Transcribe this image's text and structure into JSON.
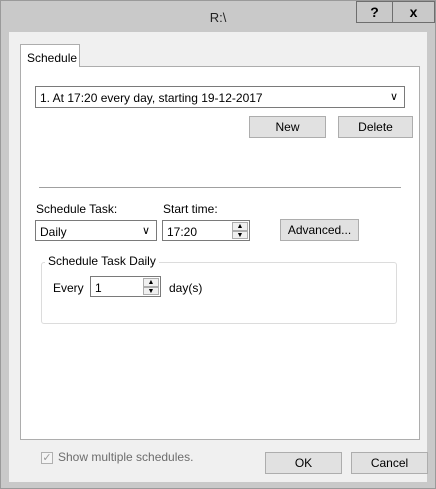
{
  "window": {
    "title": "R:\\",
    "help_label": "?",
    "close_label": "x"
  },
  "tabs": [
    {
      "label": "Schedule"
    }
  ],
  "schedule": {
    "selected": "1. At 17:20 every day, starting 19-12-2017",
    "new_label": "New",
    "delete_label": "Delete"
  },
  "task": {
    "schedule_task_label": "Schedule Task:",
    "schedule_task_value": "Daily",
    "start_time_label": "Start time:",
    "start_time_value": "17:20",
    "advanced_label": "Advanced..."
  },
  "daily": {
    "group_title": "Schedule Task Daily",
    "every_label": "Every",
    "every_value": "1",
    "unit_label": "day(s)"
  },
  "options": {
    "show_multiple_label": "Show multiple schedules.",
    "show_multiple_checked": true
  },
  "footer": {
    "ok_label": "OK",
    "cancel_label": "Cancel"
  }
}
